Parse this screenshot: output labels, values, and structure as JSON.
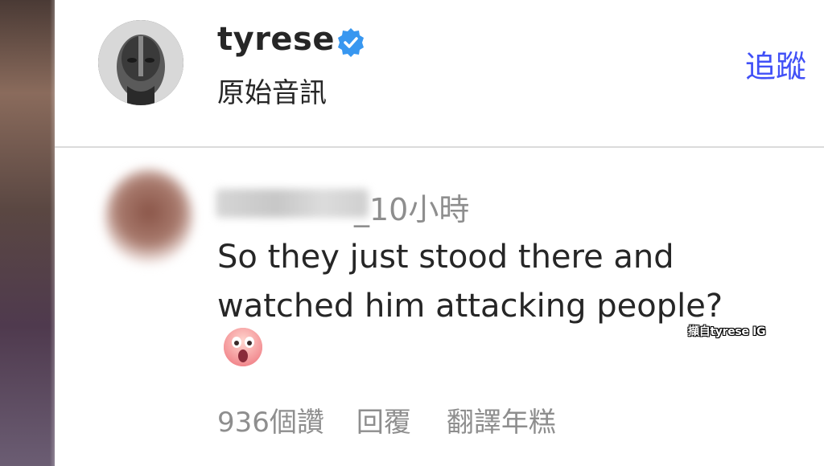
{
  "post": {
    "username": "tyrese",
    "verified_icon": "verified-badge-icon",
    "audio_label": "原始音訊",
    "follow_label": "追蹤"
  },
  "comment": {
    "time": "_10小時",
    "text_line1": "So they just stood there and",
    "text_line2": "watched him attacking people?",
    "emoji": "😮",
    "likes": "936個讚",
    "reply": "回覆",
    "translate": "翻譯年糕"
  },
  "credit": "擷自tyrese IG",
  "colors": {
    "link": "#4150f7",
    "verified": "#3897f0",
    "text": "#262626",
    "muted": "#8e8e8e"
  }
}
